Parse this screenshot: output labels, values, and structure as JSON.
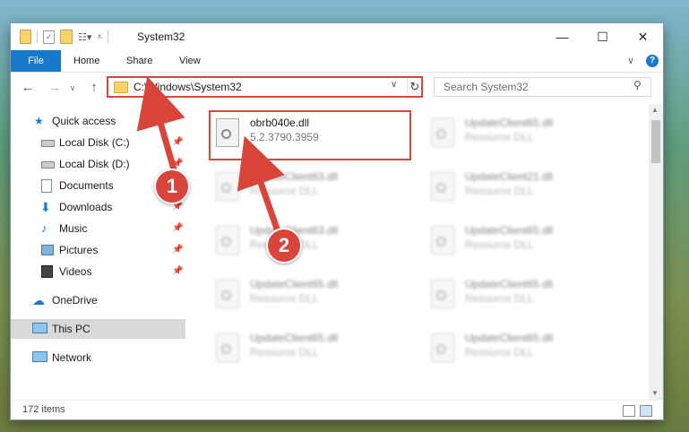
{
  "window": {
    "title": "System32"
  },
  "ribbon": {
    "tabs": [
      "File",
      "Home",
      "Share",
      "View"
    ],
    "help": "?"
  },
  "address": {
    "path": "C:\\Windows\\System32"
  },
  "search": {
    "placeholder": "Search System32"
  },
  "sidebar": {
    "items": [
      {
        "label": "Quick access",
        "icon": "star-icon",
        "pinned": false
      },
      {
        "label": "Local Disk (C:)",
        "icon": "disk-icon",
        "pinned": true
      },
      {
        "label": "Local Disk (D:)",
        "icon": "disk-icon",
        "pinned": true
      },
      {
        "label": "Documents",
        "icon": "documents-icon",
        "pinned": true
      },
      {
        "label": "Downloads",
        "icon": "download-icon",
        "pinned": true
      },
      {
        "label": "Music",
        "icon": "music-icon",
        "pinned": true
      },
      {
        "label": "Pictures",
        "icon": "pictures-icon",
        "pinned": true
      },
      {
        "label": "Videos",
        "icon": "videos-icon",
        "pinned": true
      },
      {
        "label": "OneDrive",
        "icon": "cloud-icon",
        "pinned": false
      },
      {
        "label": "This PC",
        "icon": "pc-icon",
        "pinned": false
      },
      {
        "label": "Network",
        "icon": "network-icon",
        "pinned": false
      }
    ],
    "selected": "This PC"
  },
  "files": [
    {
      "name": "obrb040e.dll",
      "sub": "5.2.3790.3959"
    },
    {
      "name": "UpdateClient65.dll",
      "sub": "Resource DLL"
    },
    {
      "name": "UpdateClient63.dll",
      "sub": "Resource DLL"
    },
    {
      "name": "UpdateClient21.dll",
      "sub": "Resource DLL"
    },
    {
      "name": "UpdateClient63.dll",
      "sub": "Resource DLL"
    },
    {
      "name": "UpdateClient65.dll",
      "sub": "Resource DLL"
    },
    {
      "name": "UpdateClient65.dll",
      "sub": "Resource DLL"
    },
    {
      "name": "UpdateClient65.dll",
      "sub": "Resource DLL"
    },
    {
      "name": "UpdateClient65.dll",
      "sub": "Resource DLL"
    },
    {
      "name": "UpdateClient65.dll",
      "sub": "Resource DLL"
    }
  ],
  "status": {
    "count": "172 items"
  },
  "callouts": [
    "1",
    "2"
  ],
  "colors": {
    "accent": "#1979ca",
    "highlight": "#d9453b",
    "selected": "#d9d9d9"
  }
}
